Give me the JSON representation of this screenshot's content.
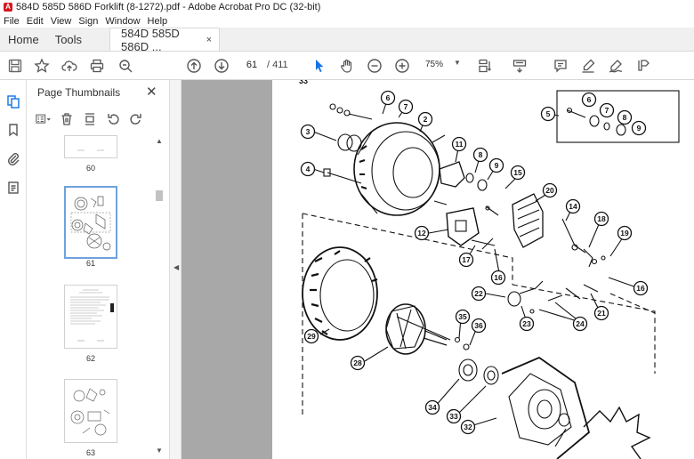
{
  "window": {
    "title": "584D 585D 586D Forklift (8-1272).pdf - Adobe Acrobat Pro DC (32-bit)",
    "app_icon_letter": "A"
  },
  "menu": [
    "File",
    "Edit",
    "View",
    "Sign",
    "Window",
    "Help"
  ],
  "tabs": {
    "home": "Home",
    "tools": "Tools",
    "doc": "584D 585D 586D ...",
    "close": "×"
  },
  "toolbar": {
    "page_current": "61",
    "page_total": "/ 411",
    "zoom": "75%"
  },
  "panel": {
    "title": "Page Thumbnails",
    "close": "✕",
    "thumbnails": [
      {
        "label": "60"
      },
      {
        "label": "61",
        "selected": true
      },
      {
        "label": "62"
      },
      {
        "label": "63"
      }
    ]
  },
  "page": {
    "top_fragment": "33",
    "callouts": [
      "6",
      "7",
      "2",
      "3",
      "11",
      "8",
      "9",
      "5",
      "6",
      "7",
      "8",
      "9",
      "4",
      "15",
      "20",
      "12",
      "14",
      "18",
      "19",
      "17",
      "16",
      "16",
      "22",
      "23",
      "24",
      "21",
      "35",
      "36",
      "29",
      "28",
      "34",
      "33",
      "32"
    ]
  },
  "colors": {
    "accent": "#1473e6",
    "selection": "#6ea2dc",
    "workspace": "#a8a8a8"
  }
}
